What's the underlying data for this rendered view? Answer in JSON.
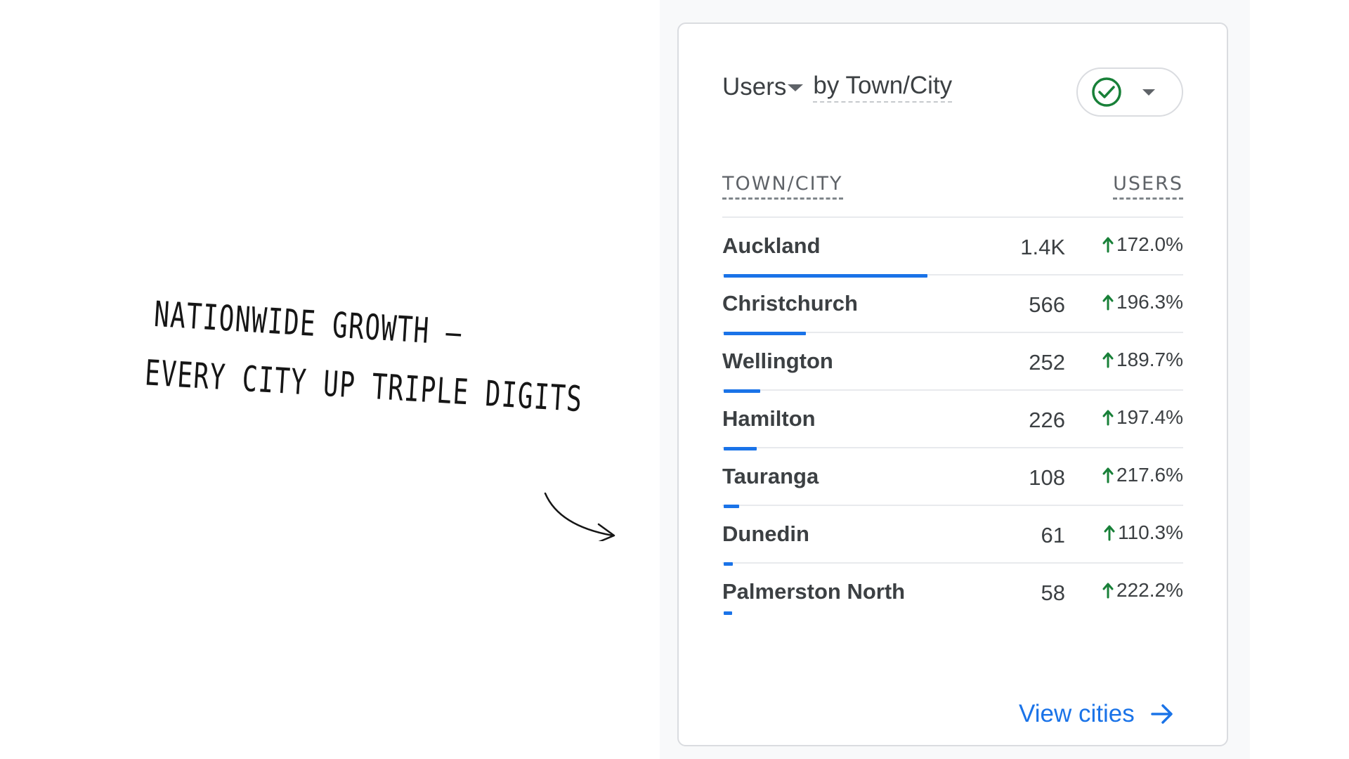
{
  "annotation": {
    "line1": "NATIONWIDE GROWTH —",
    "line2": "EVERY CITY UP TRIPLE DIGITS"
  },
  "card": {
    "metric": "Users",
    "dimension": "by Town/City",
    "compare_chip_icon": "check-circle-icon",
    "compare_chip_icon_color": "#188038",
    "columns": {
      "city": "TOWN/CITY",
      "users": "USERS"
    },
    "rows": [
      {
        "city": "Auckland",
        "users": "1.4K",
        "change": "172.0%",
        "share": 1.0
      },
      {
        "city": "Christchurch",
        "users": "566",
        "change": "196.3%",
        "share": 0.404
      },
      {
        "city": "Wellington",
        "users": "252",
        "change": "189.7%",
        "share": 0.18
      },
      {
        "city": "Hamilton",
        "users": "226",
        "change": "197.4%",
        "share": 0.161
      },
      {
        "city": "Tauranga",
        "users": "108",
        "change": "217.6%",
        "share": 0.077
      },
      {
        "city": "Dunedin",
        "users": "61",
        "change": "110.3%",
        "share": 0.044
      },
      {
        "city": "Palmerston North",
        "users": "58",
        "change": "222.2%",
        "share": 0.041
      }
    ],
    "view_link": "View cities",
    "colors": {
      "accent": "#1a73e8",
      "positive": "#188038"
    }
  }
}
